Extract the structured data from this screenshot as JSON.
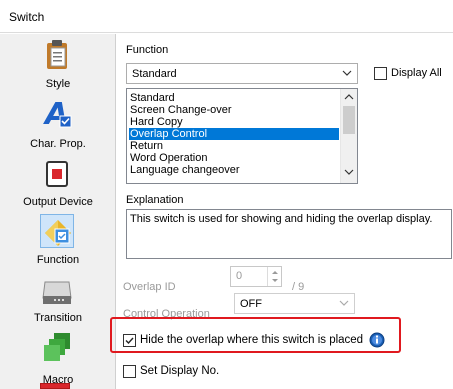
{
  "window": {
    "title": "Switch"
  },
  "sidebar": {
    "items": [
      {
        "label": "Style",
        "icon": "clipboard-icon"
      },
      {
        "label": "Char. Prop.",
        "icon": "font-a-icon"
      },
      {
        "label": "Output Device",
        "icon": "device-icon"
      },
      {
        "label": "Function",
        "icon": "function-icon",
        "selected": true
      },
      {
        "label": "Transition",
        "icon": "transition-icon"
      },
      {
        "label": "Macro",
        "icon": "macro-icon"
      }
    ]
  },
  "function": {
    "label": "Function",
    "selected": "Standard",
    "display_all_label": "Display All",
    "display_all_checked": false,
    "options": [
      "Standard",
      "Screen Change-over",
      "Hard Copy",
      "Overlap Control",
      "Return",
      "Word Operation",
      "Language changeover"
    ],
    "selected_option_index": 3
  },
  "explanation": {
    "label": "Explanation",
    "text": "This switch is used for showing and hiding the overlap display."
  },
  "overlap_id": {
    "label": "Overlap ID",
    "value": "0",
    "max": "/ 9"
  },
  "control_operation": {
    "label": "Control Operation",
    "value": "OFF"
  },
  "hide_overlap": {
    "label": "Hide the overlap where this switch is placed",
    "checked": true
  },
  "set_display": {
    "label": "Set Display No.",
    "checked": false
  },
  "colors": {
    "selection": "#0078d7",
    "highlight_border": "#e0191f",
    "info_icon": "#1a5fb4"
  }
}
